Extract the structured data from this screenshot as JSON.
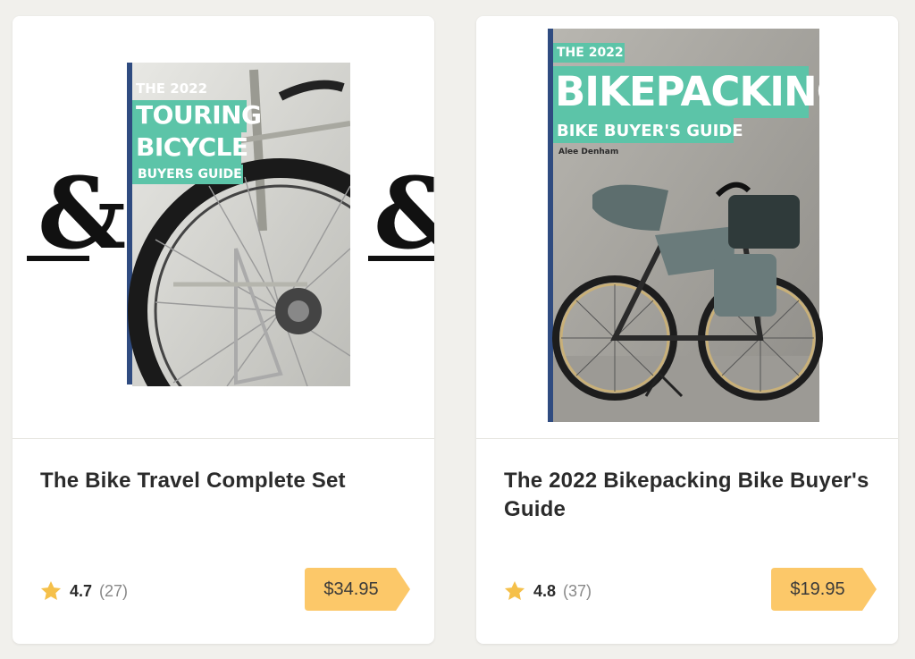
{
  "products": [
    {
      "title": "The Bike Travel Complete Set",
      "rating": "4.7",
      "reviews": "(27)",
      "price": "$34.95",
      "cover": {
        "year": "THE 2022",
        "line1": "TOURING",
        "line2": "BICYCLE",
        "line3": "BUYERS GUIDE",
        "symbol": "&"
      }
    },
    {
      "title": "The 2022 Bikepacking Bike Buyer's Guide",
      "rating": "4.8",
      "reviews": "(37)",
      "price": "$19.95",
      "cover": {
        "year": "THE 2022",
        "line1": "BIKEPACKING",
        "line2": "BIKE BUYER'S GUIDE",
        "author": "Alee Denham"
      }
    }
  ],
  "colors": {
    "background": "#f1f0ec",
    "price_tag": "#fcc869",
    "star": "#f5c04a",
    "cover_accent": "#5cc4a8"
  },
  "icons": [
    "star-icon",
    "price-tag-icon"
  ]
}
